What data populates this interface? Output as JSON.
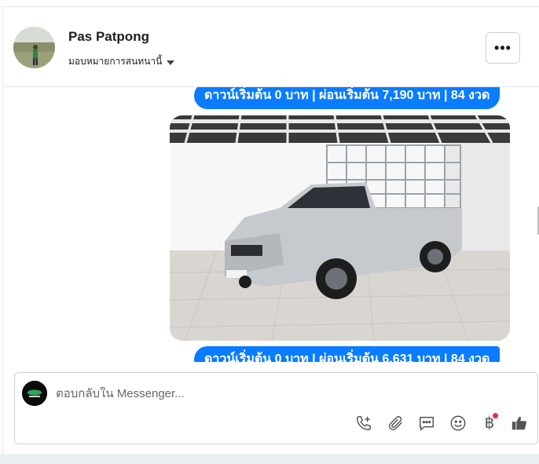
{
  "header": {
    "name": "Pas Patpong",
    "assign_label": "มอบหมายการสนทนานี้",
    "more_icon": "more-options-icon"
  },
  "messages": [
    {
      "type": "text",
      "text": "ดาวน์เริ่มต้น 0 บาท | ผ่อนเริ่มต้น 7,190 บาท | 84 งวด"
    },
    {
      "type": "image",
      "subject": "silver pickup truck with metal cargo cage in showroom"
    },
    {
      "type": "text",
      "text": "ดาวน์เริ่มต้น 0 บาท | ผ่อนเริ่มต้น 6,631 บาท | 84 งวด"
    }
  ],
  "composer": {
    "placeholder": "ตอบกลับใน Messenger...",
    "tools": [
      "phone-add-icon",
      "paperclip-icon",
      "saved-reply-icon",
      "emoji-icon",
      "baht-icon",
      "thumbs-up-icon"
    ],
    "baht_symbol": "฿"
  },
  "colors": {
    "bubble": "#0a7cff",
    "notification_dot": "#f02849",
    "divider": "#e4e6eb"
  }
}
